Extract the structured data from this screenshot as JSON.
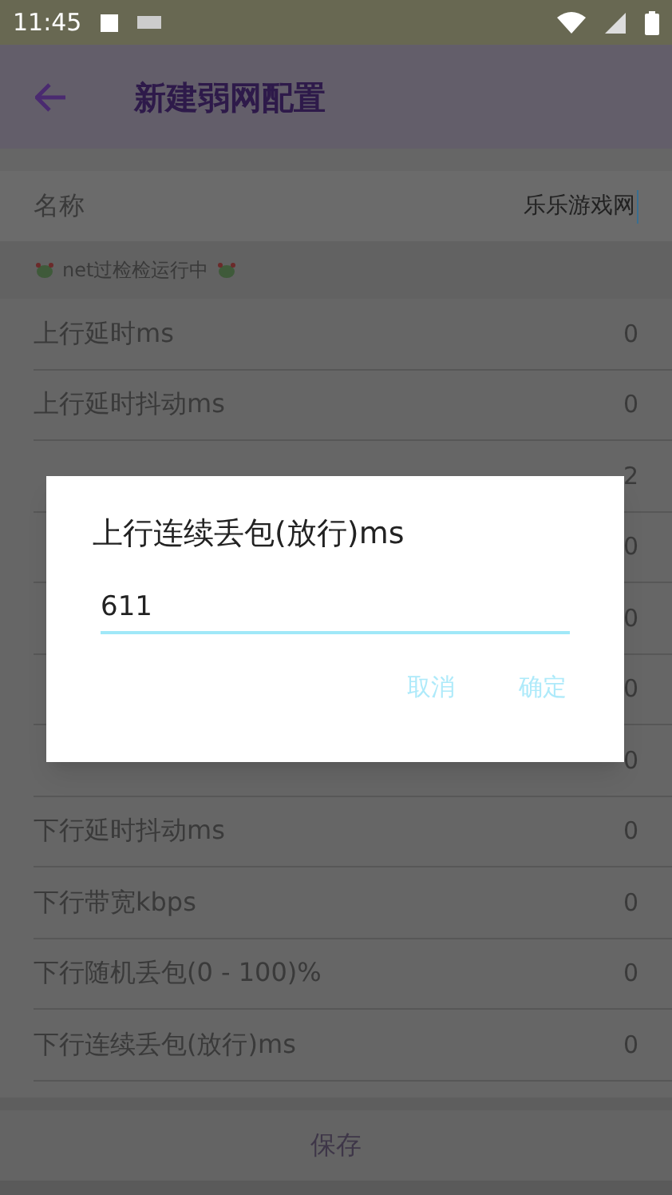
{
  "status_bar": {
    "time": "11:45"
  },
  "toolbar": {
    "title": "新建弱网配置"
  },
  "name_row": {
    "label": "名称",
    "value": "乐乐游戏网"
  },
  "notice": {
    "text": "net过检检运行中"
  },
  "rows": [
    {
      "label": "上行延时ms",
      "value": "0"
    },
    {
      "label": "上行延时抖动ms",
      "value": "0"
    },
    {
      "value": "2"
    },
    {
      "value": "0"
    },
    {
      "value": "0"
    },
    {
      "value": "0"
    },
    {
      "value": "0"
    },
    {
      "label": "下行延时抖动ms",
      "value": "0"
    },
    {
      "label": "下行带宽kbps",
      "value": "0"
    },
    {
      "label": "下行随机丢包(0 - 100)%",
      "value": "0"
    },
    {
      "label": "下行连续丢包(放行)ms",
      "value": "0"
    }
  ],
  "save_button": {
    "label": "保存"
  },
  "dialog": {
    "title": "上行连续丢包(放行)ms",
    "input": {
      "value": "611"
    },
    "buttons": [
      "取消",
      "确定"
    ]
  }
}
